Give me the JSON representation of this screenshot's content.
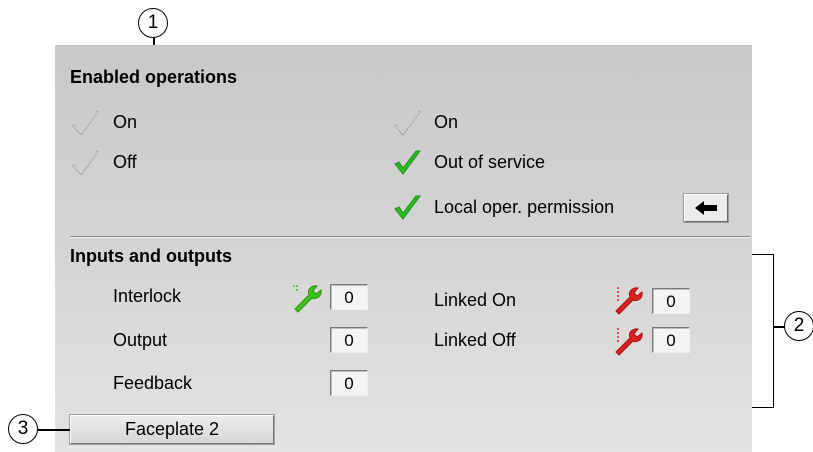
{
  "enabled_operations": {
    "title": "Enabled operations",
    "left": [
      {
        "label": "On",
        "enabled": false
      },
      {
        "label": "Off",
        "enabled": false
      }
    ],
    "right": [
      {
        "label": "On",
        "enabled": false
      },
      {
        "label": "Out of service",
        "enabled": true
      },
      {
        "label": "Local oper. permission",
        "enabled": true
      }
    ]
  },
  "inputs_outputs": {
    "title": "Inputs and outputs",
    "interlock": {
      "label": "Interlock",
      "value": "0"
    },
    "output": {
      "label": "Output",
      "value": "0"
    },
    "feedback": {
      "label": "Feedback",
      "value": "0"
    },
    "linked_on": {
      "label": "Linked On",
      "value": "0"
    },
    "linked_off": {
      "label": "Linked Off",
      "value": "0"
    }
  },
  "faceplate_button": "Faceplate 2",
  "callouts": {
    "one": "1",
    "two": "2",
    "three": "3"
  },
  "colors": {
    "check_enabled": "#2bbd1f",
    "check_disabled": "#a8a8a8",
    "wrench_green": "#3cc21a",
    "wrench_red": "#e02020"
  },
  "icons": {
    "check": "checkmark-icon",
    "wrench": "wrench-icon",
    "arrow": "arrow-left-icon"
  }
}
